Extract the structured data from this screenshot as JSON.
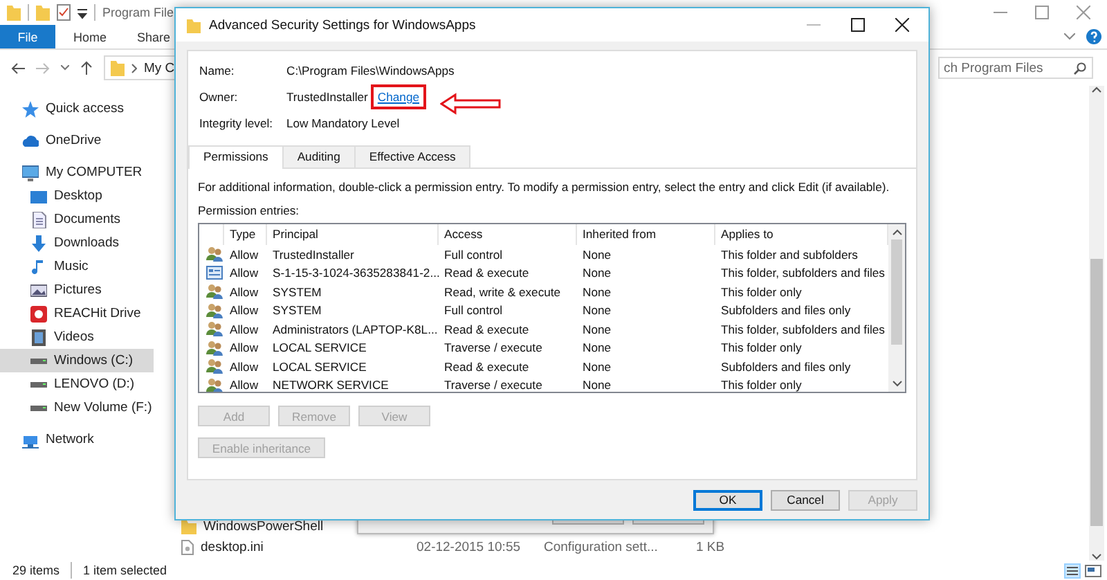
{
  "explorer": {
    "window_title": "Program File",
    "file_tab": "File",
    "ribbon_tabs": [
      {
        "label": "Home"
      },
      {
        "label": "Share"
      }
    ],
    "address_path": "My C",
    "search": {
      "placeholder": "ch Program Files"
    },
    "sidebar": [
      {
        "label": "Quick access",
        "kind": "star",
        "selected": false
      },
      {
        "label": "OneDrive",
        "kind": "cloud",
        "selected": false
      },
      {
        "label": "My COMPUTER",
        "kind": "computer",
        "selected": false,
        "children": [
          {
            "label": "Desktop",
            "kind": "desktop",
            "selected": false
          },
          {
            "label": "Documents",
            "kind": "documents",
            "selected": false
          },
          {
            "label": "Downloads",
            "kind": "downloads",
            "selected": false
          },
          {
            "label": "Music",
            "kind": "music",
            "selected": false
          },
          {
            "label": "Pictures",
            "kind": "pictures",
            "selected": false
          },
          {
            "label": "REACHit Drive",
            "kind": "app",
            "selected": false
          },
          {
            "label": "Videos",
            "kind": "videos",
            "selected": false
          },
          {
            "label": "Windows (C:)",
            "kind": "drive",
            "selected": true
          },
          {
            "label": "LENOVO (D:)",
            "kind": "drive",
            "selected": false
          },
          {
            "label": "New Volume (F:)",
            "kind": "drive",
            "selected": false
          }
        ]
      },
      {
        "label": "Network",
        "kind": "network",
        "selected": false
      }
    ],
    "files": [
      {
        "kind": "folder",
        "name": "WindowsPowerShell"
      },
      {
        "kind": "file",
        "name": "desktop.ini",
        "date": "02-12-2015 10:55",
        "type": "Configuration sett...",
        "size": "1 KB"
      }
    ],
    "status": {
      "count": "29 items",
      "selection": "1 item selected"
    }
  },
  "dialog": {
    "title": "Advanced Security Settings for WindowsApps",
    "fields": [
      {
        "label": "Name:",
        "value": "C:\\Program Files\\WindowsApps"
      },
      {
        "label": "Owner:",
        "value": "TrustedInstaller",
        "link": "Change",
        "highlighted": true
      },
      {
        "label": "Integrity level:",
        "value": "Low Mandatory Level"
      }
    ],
    "tabs": [
      {
        "label": "Permissions",
        "selected": true
      },
      {
        "label": "Auditing",
        "selected": false
      },
      {
        "label": "Effective Access",
        "selected": false
      }
    ],
    "info": "For additional information, double-click a permission entry. To modify a permission entry, select the entry and click Edit (if available).",
    "entries_label": "Permission entries:",
    "table": {
      "columns": [
        "Type",
        "Principal",
        "Access",
        "Inherited from",
        "Applies to"
      ],
      "rows": [
        {
          "kind": "group",
          "cells": [
            "Allow",
            "TrustedInstaller",
            "Full control",
            "None",
            "This folder and subfolders"
          ]
        },
        {
          "kind": "package",
          "cells": [
            "Allow",
            "S-1-15-3-1024-3635283841-2...",
            "Read & execute",
            "None",
            "This folder, subfolders and files"
          ]
        },
        {
          "kind": "group",
          "cells": [
            "Allow",
            "SYSTEM",
            "Read, write & execute",
            "None",
            "This folder only"
          ]
        },
        {
          "kind": "group",
          "cells": [
            "Allow",
            "SYSTEM",
            "Full control",
            "None",
            "Subfolders and files only"
          ]
        },
        {
          "kind": "group",
          "cells": [
            "Allow",
            "Administrators (LAPTOP-K8L...",
            "Read & execute",
            "None",
            "This folder, subfolders and files"
          ]
        },
        {
          "kind": "group",
          "cells": [
            "Allow",
            "LOCAL SERVICE",
            "Traverse / execute",
            "None",
            "This folder only"
          ]
        },
        {
          "kind": "group",
          "cells": [
            "Allow",
            "LOCAL SERVICE",
            "Read & execute",
            "None",
            "Subfolders and files only"
          ]
        },
        {
          "kind": "group",
          "cells": [
            "Allow",
            "NETWORK SERVICE",
            "Traverse / execute",
            "None",
            "This folder only"
          ]
        }
      ]
    },
    "entry_buttons": [
      {
        "label": "Add",
        "disabled": true
      },
      {
        "label": "Remove",
        "disabled": true
      },
      {
        "label": "View",
        "disabled": true
      }
    ],
    "inherit_button": {
      "label": "Enable inheritance",
      "disabled": true
    },
    "footer_buttons": [
      {
        "label": "OK",
        "default": true,
        "disabled": false
      },
      {
        "label": "Cancel",
        "default": false,
        "disabled": false
      },
      {
        "label": "Apply",
        "default": false,
        "disabled": true
      }
    ]
  }
}
